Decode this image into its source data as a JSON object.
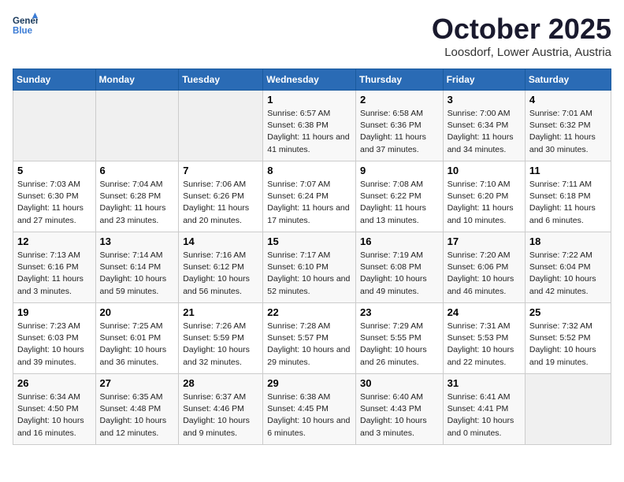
{
  "header": {
    "logo_line1": "General",
    "logo_line2": "Blue",
    "month": "October 2025",
    "location": "Loosdorf, Lower Austria, Austria"
  },
  "weekdays": [
    "Sunday",
    "Monday",
    "Tuesday",
    "Wednesday",
    "Thursday",
    "Friday",
    "Saturday"
  ],
  "weeks": [
    [
      {
        "day": "",
        "empty": true
      },
      {
        "day": "",
        "empty": true
      },
      {
        "day": "",
        "empty": true
      },
      {
        "day": "1",
        "sunrise": "6:57 AM",
        "sunset": "6:38 PM",
        "daylight": "11 hours and 41 minutes."
      },
      {
        "day": "2",
        "sunrise": "6:58 AM",
        "sunset": "6:36 PM",
        "daylight": "11 hours and 37 minutes."
      },
      {
        "day": "3",
        "sunrise": "7:00 AM",
        "sunset": "6:34 PM",
        "daylight": "11 hours and 34 minutes."
      },
      {
        "day": "4",
        "sunrise": "7:01 AM",
        "sunset": "6:32 PM",
        "daylight": "11 hours and 30 minutes."
      }
    ],
    [
      {
        "day": "5",
        "sunrise": "7:03 AM",
        "sunset": "6:30 PM",
        "daylight": "11 hours and 27 minutes."
      },
      {
        "day": "6",
        "sunrise": "7:04 AM",
        "sunset": "6:28 PM",
        "daylight": "11 hours and 23 minutes."
      },
      {
        "day": "7",
        "sunrise": "7:06 AM",
        "sunset": "6:26 PM",
        "daylight": "11 hours and 20 minutes."
      },
      {
        "day": "8",
        "sunrise": "7:07 AM",
        "sunset": "6:24 PM",
        "daylight": "11 hours and 17 minutes."
      },
      {
        "day": "9",
        "sunrise": "7:08 AM",
        "sunset": "6:22 PM",
        "daylight": "11 hours and 13 minutes."
      },
      {
        "day": "10",
        "sunrise": "7:10 AM",
        "sunset": "6:20 PM",
        "daylight": "11 hours and 10 minutes."
      },
      {
        "day": "11",
        "sunrise": "7:11 AM",
        "sunset": "6:18 PM",
        "daylight": "11 hours and 6 minutes."
      }
    ],
    [
      {
        "day": "12",
        "sunrise": "7:13 AM",
        "sunset": "6:16 PM",
        "daylight": "11 hours and 3 minutes."
      },
      {
        "day": "13",
        "sunrise": "7:14 AM",
        "sunset": "6:14 PM",
        "daylight": "10 hours and 59 minutes."
      },
      {
        "day": "14",
        "sunrise": "7:16 AM",
        "sunset": "6:12 PM",
        "daylight": "10 hours and 56 minutes."
      },
      {
        "day": "15",
        "sunrise": "7:17 AM",
        "sunset": "6:10 PM",
        "daylight": "10 hours and 52 minutes."
      },
      {
        "day": "16",
        "sunrise": "7:19 AM",
        "sunset": "6:08 PM",
        "daylight": "10 hours and 49 minutes."
      },
      {
        "day": "17",
        "sunrise": "7:20 AM",
        "sunset": "6:06 PM",
        "daylight": "10 hours and 46 minutes."
      },
      {
        "day": "18",
        "sunrise": "7:22 AM",
        "sunset": "6:04 PM",
        "daylight": "10 hours and 42 minutes."
      }
    ],
    [
      {
        "day": "19",
        "sunrise": "7:23 AM",
        "sunset": "6:03 PM",
        "daylight": "10 hours and 39 minutes."
      },
      {
        "day": "20",
        "sunrise": "7:25 AM",
        "sunset": "6:01 PM",
        "daylight": "10 hours and 36 minutes."
      },
      {
        "day": "21",
        "sunrise": "7:26 AM",
        "sunset": "5:59 PM",
        "daylight": "10 hours and 32 minutes."
      },
      {
        "day": "22",
        "sunrise": "7:28 AM",
        "sunset": "5:57 PM",
        "daylight": "10 hours and 29 minutes."
      },
      {
        "day": "23",
        "sunrise": "7:29 AM",
        "sunset": "5:55 PM",
        "daylight": "10 hours and 26 minutes."
      },
      {
        "day": "24",
        "sunrise": "7:31 AM",
        "sunset": "5:53 PM",
        "daylight": "10 hours and 22 minutes."
      },
      {
        "day": "25",
        "sunrise": "7:32 AM",
        "sunset": "5:52 PM",
        "daylight": "10 hours and 19 minutes."
      }
    ],
    [
      {
        "day": "26",
        "sunrise": "6:34 AM",
        "sunset": "4:50 PM",
        "daylight": "10 hours and 16 minutes."
      },
      {
        "day": "27",
        "sunrise": "6:35 AM",
        "sunset": "4:48 PM",
        "daylight": "10 hours and 12 minutes."
      },
      {
        "day": "28",
        "sunrise": "6:37 AM",
        "sunset": "4:46 PM",
        "daylight": "10 hours and 9 minutes."
      },
      {
        "day": "29",
        "sunrise": "6:38 AM",
        "sunset": "4:45 PM",
        "daylight": "10 hours and 6 minutes."
      },
      {
        "day": "30",
        "sunrise": "6:40 AM",
        "sunset": "4:43 PM",
        "daylight": "10 hours and 3 minutes."
      },
      {
        "day": "31",
        "sunrise": "6:41 AM",
        "sunset": "4:41 PM",
        "daylight": "10 hours and 0 minutes."
      },
      {
        "day": "",
        "empty": true
      }
    ]
  ]
}
